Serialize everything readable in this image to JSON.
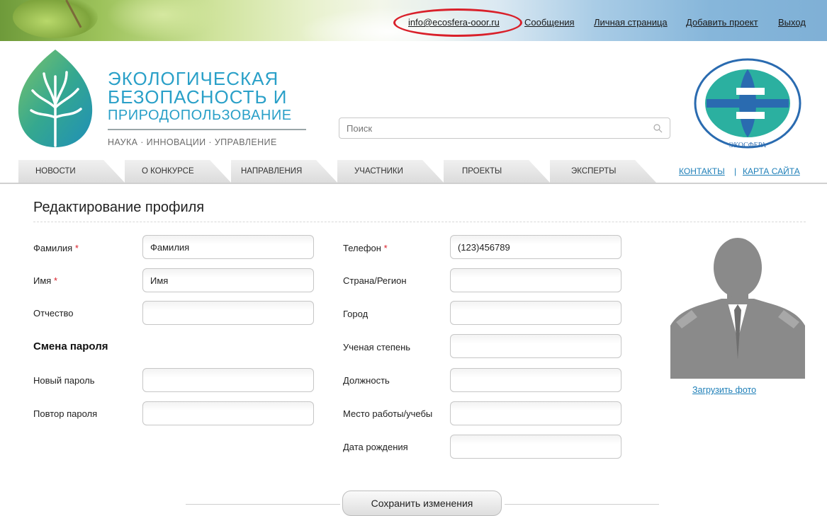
{
  "top_links": {
    "email": "info@ecosfera-ooor.ru",
    "messages": "Сообщения",
    "personal_page": "Личная страница",
    "add_project": "Добавить проект",
    "logout": "Выход"
  },
  "logo": {
    "line1": "ЭКОЛОГИЧЕСКАЯ",
    "line2": "БЕЗОПАСНОСТЬ И",
    "line3": "ПРИРОДОПОЛЬЗОВАНИЕ",
    "tagline": "НАУКА · ИННОВАЦИИ · УПРАВЛЕНИЕ"
  },
  "search": {
    "placeholder": "Поиск"
  },
  "emblem": {
    "text": "ЭКОСФЕРА"
  },
  "nav": {
    "tabs": [
      "НОВОСТИ",
      "О КОНКУРСЕ",
      "НАПРАВЛЕНИЯ",
      "УЧАСТНИКИ",
      "ПРОЕКТЫ",
      "ЭКСПЕРТЫ"
    ],
    "contacts": "КОНТАКТЫ",
    "separator": "|",
    "sitemap": "КАРТА САЙТА"
  },
  "form": {
    "title": "Редактирование профиля",
    "required_mark": "*",
    "last_name": {
      "label": "Фамилия",
      "value": "Фамилия"
    },
    "first_name": {
      "label": "Имя",
      "value": "Имя"
    },
    "middle_name": {
      "label": "Отчество",
      "value": ""
    },
    "password_section": "Смена пароля",
    "new_password": {
      "label": "Новый пароль",
      "value": ""
    },
    "repeat_password": {
      "label": "Повтор пароля",
      "value": ""
    },
    "phone": {
      "label": "Телефон",
      "value": "(123)456789"
    },
    "country": {
      "label": "Страна/Регион",
      "value": ""
    },
    "city": {
      "label": "Город",
      "value": ""
    },
    "degree": {
      "label": "Ученая степень",
      "value": ""
    },
    "position": {
      "label": "Должность",
      "value": ""
    },
    "workplace": {
      "label": "Место работы/учебы",
      "value": ""
    },
    "birthdate": {
      "label": "Дата рождения",
      "value": ""
    }
  },
  "photo": {
    "upload_label": "Загрузить фото"
  },
  "save_button": "Сохранить изменения",
  "colors": {
    "link": "#1e7fb8",
    "logo": "#2aa0c8",
    "required": "#d9202a",
    "highlight_oval": "#d9202a"
  }
}
